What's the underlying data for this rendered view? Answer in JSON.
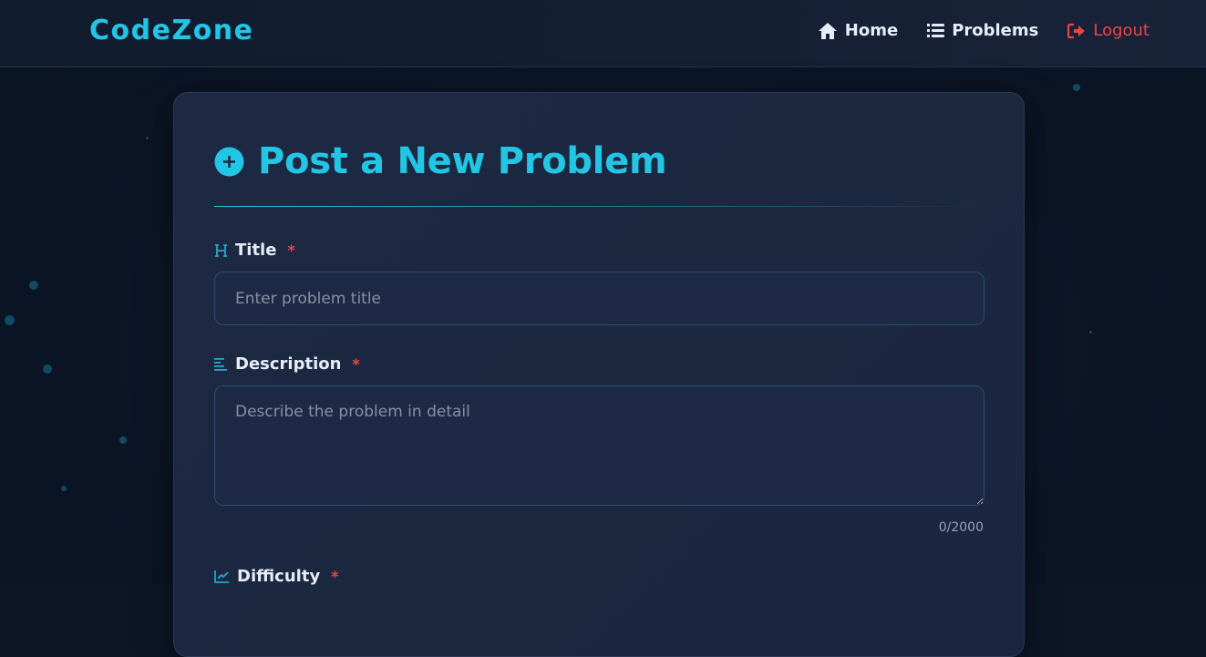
{
  "navbar": {
    "brand": "CodeZone",
    "links": [
      {
        "label": "Home",
        "icon": "home-icon"
      },
      {
        "label": "Problems",
        "icon": "list-icon"
      },
      {
        "label": "Logout",
        "icon": "logout-icon"
      }
    ]
  },
  "form": {
    "title": "Post a New Problem",
    "title_icon": "plus-circle-icon",
    "fields": {
      "title": {
        "label": "Title",
        "required_mark": "*",
        "placeholder": "Enter problem title",
        "value": "",
        "icon": "heading-icon"
      },
      "description": {
        "label": "Description",
        "required_mark": "*",
        "placeholder": "Describe the problem in detail",
        "value": "",
        "counter": "0/2000",
        "icon": "align-left-icon"
      },
      "difficulty": {
        "label": "Difficulty",
        "required_mark": "*",
        "icon": "chart-line-icon"
      }
    }
  },
  "colors": {
    "accent": "#22c6e4",
    "danger": "#ef4444",
    "background": "#0c1626",
    "card": "#1d2942"
  }
}
